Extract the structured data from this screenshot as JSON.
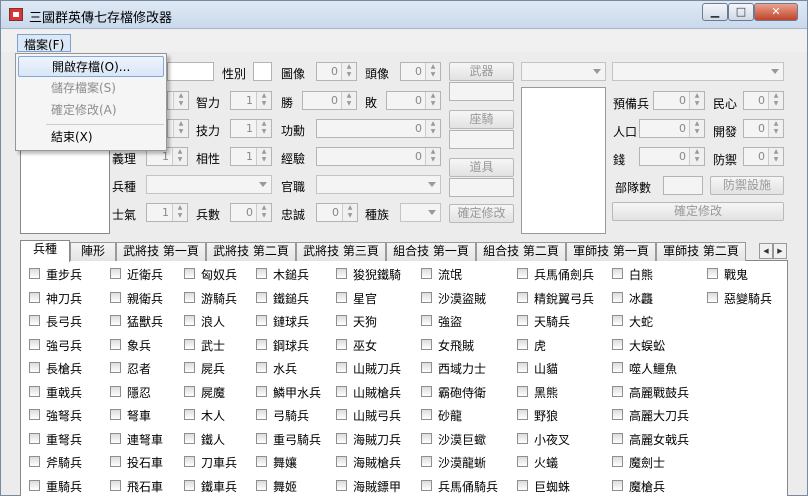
{
  "window": {
    "title": "三國群英傳七存檔修改器",
    "min_label": "▁",
    "max_label": "□",
    "close_label": "✕"
  },
  "menubar": {
    "file_menu": "檔案(F)"
  },
  "file_menu_items": [
    {
      "label": "開啟存檔(O)...",
      "enabled": true,
      "highlighted": true
    },
    {
      "label": "儲存檔案(S)",
      "enabled": false
    },
    {
      "label": "確定修改(A)",
      "enabled": false
    },
    {
      "label": "結束(X)",
      "enabled": true
    }
  ],
  "form": {
    "gender_label": "性別",
    "intellect_label": "智力",
    "skill_label": "技力",
    "loyalty_name_label": "義理",
    "affinity_label": "相性",
    "soldier_type_label": "兵種",
    "morale_label": "士氣",
    "troops_label": "兵數",
    "portrait_label": "圖像",
    "head_label": "頭像",
    "win_label": "勝",
    "lose_label": "敗",
    "merit_label": "功勳",
    "exp_label": "經驗",
    "rank_label": "官職",
    "loyalty_label": "忠誠",
    "race_label": "種族",
    "weapon_btn": "武器",
    "mount_btn": "座騎",
    "item_btn": "道具",
    "confirm_btn": "確定修改",
    "reserve_label": "預備兵",
    "popularity_label": "民心",
    "population_label": "人口",
    "develop_label": "開發",
    "money_label": "錢",
    "defense_label": "防禦",
    "corps_label": "部隊數",
    "defense_build_btn": "防禦設施",
    "confirm_btn2": "確定修改",
    "spin_values": {
      "intellect": "1",
      "skill": "1",
      "loyalty_name": "1",
      "affinity": "1",
      "morale": "1",
      "troops": "0",
      "portrait": "0",
      "head": "0",
      "win": "0",
      "lose": "0",
      "merit": "0",
      "exp": "0",
      "loyalty": "0",
      "reserve": "0",
      "popularity": "0",
      "population": "0",
      "develop": "0",
      "money": "0",
      "defense": "0"
    }
  },
  "tabs": [
    {
      "label": "兵種",
      "active": true
    },
    {
      "label": "陣形"
    },
    {
      "label": "武將技 第一頁"
    },
    {
      "label": "武將技 第二頁"
    },
    {
      "label": "武將技 第三頁"
    },
    {
      "label": "組合技 第一頁"
    },
    {
      "label": "組合技 第二頁"
    },
    {
      "label": "軍師技 第一頁"
    },
    {
      "label": "軍師技 第二頁"
    }
  ],
  "tab_scroll": {
    "left": "◀",
    "right": "▶"
  },
  "soldier_columns": [
    [
      "重步兵",
      "神刀兵",
      "長弓兵",
      "強弓兵",
      "長槍兵",
      "重戟兵",
      "強弩兵",
      "重弩兵",
      "斧騎兵",
      "重騎兵"
    ],
    [
      "近衛兵",
      "親衛兵",
      "猛獸兵",
      "象兵",
      "忍者",
      "隱忍",
      "弩車",
      "連弩車",
      "投石車",
      "飛石車"
    ],
    [
      "匈奴兵",
      "游騎兵",
      "浪人",
      "武士",
      "屍兵",
      "屍魔",
      "木人",
      "鐵人",
      "刀車兵",
      "鐵車兵"
    ],
    [
      "木鎚兵",
      "鐵鎚兵",
      "鏈球兵",
      "鋼球兵",
      "水兵",
      "鱗甲水兵",
      "弓騎兵",
      "重弓騎兵",
      "舞孃",
      "舞姬"
    ],
    [
      "狻猊鐵騎",
      "星官",
      "天狗",
      "巫女",
      "山賊刀兵",
      "山賊槍兵",
      "山賊弓兵",
      "海賊刀兵",
      "海賊槍兵",
      "海賊鏢甲"
    ],
    [
      "流氓",
      "沙漠盜賊",
      "強盜",
      "女飛賊",
      "西域力士",
      "霸砲侍衛",
      "砂龍",
      "沙漠巨蠍",
      "沙漠龍蜥",
      "兵馬俑騎兵"
    ],
    [
      "兵馬俑劍兵",
      "精銳翼弓兵",
      "天騎兵",
      "虎",
      "山貓",
      "黑熊",
      "野狼",
      "小夜叉",
      "火蟻",
      "巨蜘蛛"
    ],
    [
      "白熊",
      "冰龘",
      "大蛇",
      "大蜈蚣",
      "噬人鱷魚",
      "高麗戰鼓兵",
      "高麗大刀兵",
      "高麗女戟兵",
      "魔劍士",
      "魔槍兵"
    ],
    [
      "戰鬼",
      "惡變騎兵"
    ]
  ]
}
